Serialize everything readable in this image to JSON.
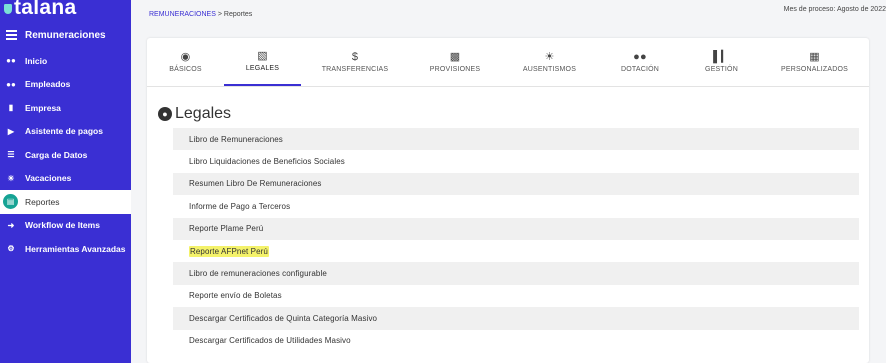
{
  "app": {
    "logo": "talana",
    "module": "Remuneraciones"
  },
  "sidebar": {
    "items": [
      {
        "label": "Inicio",
        "icon": "users-icon"
      },
      {
        "label": "Empleados",
        "icon": "users-icon"
      },
      {
        "label": "Empresa",
        "icon": "building-icon"
      },
      {
        "label": "Asistente de pagos",
        "icon": "play-icon"
      },
      {
        "label": "Carga de Datos",
        "icon": "list-icon"
      },
      {
        "label": "Vacaciones",
        "icon": "sun-icon"
      },
      {
        "label": "Reportes",
        "icon": "report-icon",
        "active": true
      },
      {
        "label": "Workflow de Items",
        "icon": "arrow-right-icon"
      },
      {
        "label": "Herramientas Avanzadas",
        "icon": "gear-icon"
      }
    ]
  },
  "breadcrumb": {
    "parent": "REMUNERACIONES",
    "separator": " > ",
    "current": "Reportes"
  },
  "period": "Mes de proceso: Agosto de 2022",
  "tabs": [
    {
      "label": "BÁSICOS",
      "icon": "user-circle-icon"
    },
    {
      "label": "LEGALES",
      "icon": "document-icon",
      "active": true
    },
    {
      "label": "TRANSFERENCIAS",
      "icon": "dollar-icon"
    },
    {
      "label": "PROVISIONES",
      "icon": "inbox-icon"
    },
    {
      "label": "AUSENTISMOS",
      "icon": "sun-icon"
    },
    {
      "label": "DOTACIÓN",
      "icon": "people-icon"
    },
    {
      "label": "GESTIÓN",
      "icon": "bar-chart-icon"
    },
    {
      "label": "PERSONALIZADOS",
      "icon": "grid-icon"
    }
  ],
  "section": {
    "title": "Legales",
    "icon": "user-circle-icon"
  },
  "reports": [
    "Libro de Remuneraciones",
    "Libro Liquidaciones de Beneficios Sociales",
    "Resumen Libro De Remuneraciones",
    "Informe de Pago a Terceros",
    "Reporte Plame Perú",
    "Reporte AFPnet Perú",
    "Libro de remuneraciones configurable",
    "Reporte envío de Boletas",
    "Descargar Certificados de Quinta Categoría Masivo",
    "Descargar Certificados de Utilidades Masivo"
  ],
  "colors": {
    "sidebar": "#3a2fd3",
    "active_icon": "#16a394",
    "highlight": "#f4f26a"
  }
}
